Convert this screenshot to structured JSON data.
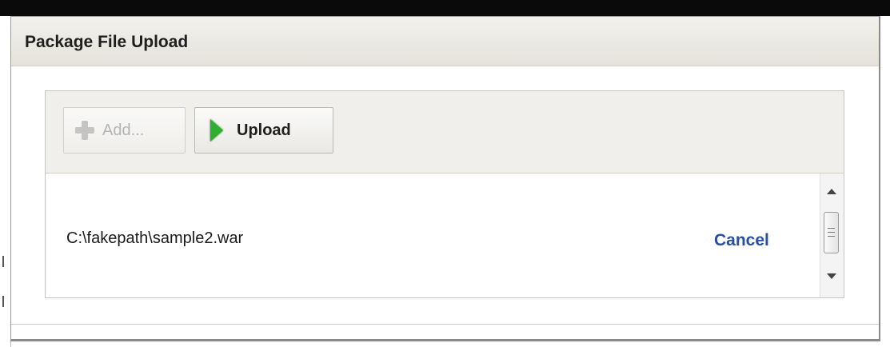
{
  "dialog": {
    "title": "Package File Upload"
  },
  "toolbar": {
    "add_label": "Add...",
    "add_icon": "plus-icon",
    "add_enabled": false,
    "upload_label": "Upload",
    "upload_icon": "play-arrow-icon"
  },
  "file_list": {
    "items": [
      {
        "file_name": "C:\\fakepath\\sample2.war",
        "action_label": "Cancel"
      }
    ]
  },
  "colors": {
    "link": "#2a4fa0",
    "upload_icon": "#2fae2f",
    "disabled_text": "#b4b4b4"
  }
}
